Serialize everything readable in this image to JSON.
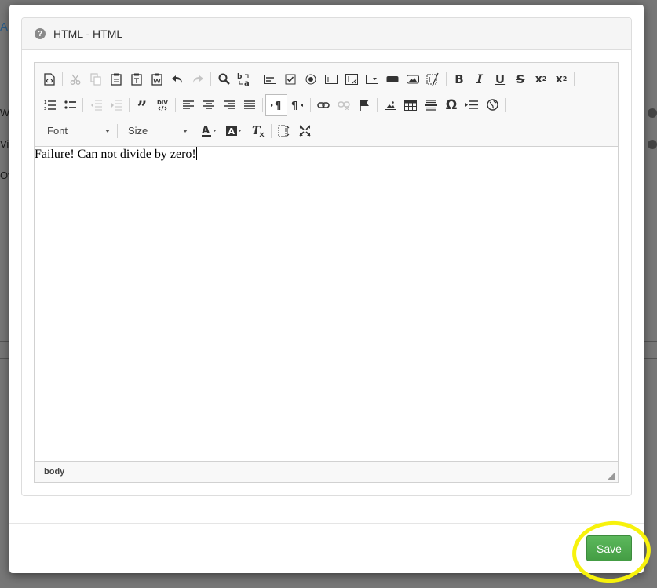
{
  "background": {
    "fragments": [
      "Al",
      "Wa",
      "Vis",
      "Ov"
    ]
  },
  "dialog": {
    "title": "HTML - HTML",
    "title_icon": "question-circle-icon"
  },
  "toolbar": {
    "font_label": "Font",
    "size_label": "Size",
    "row1_icons": [
      "source-icon",
      "cut-icon",
      "copy-icon",
      "paste-icon",
      "paste-text-icon",
      "paste-word-icon",
      "undo-icon",
      "redo-icon",
      "find-icon",
      "replace-icon",
      "form-icon",
      "checkbox-icon",
      "radio-icon",
      "textfield-icon",
      "textarea-icon",
      "select-icon",
      "button-icon",
      "image-button-icon",
      "hidden-field-icon",
      "bold-icon",
      "italic-icon",
      "underline-icon",
      "strike-icon",
      "subscript-icon",
      "superscript-icon"
    ],
    "row2_icons": [
      "numbered-list-icon",
      "bulleted-list-icon",
      "outdent-icon",
      "indent-icon",
      "blockquote-icon",
      "div-icon",
      "align-left-icon",
      "align-center-icon",
      "align-right-icon",
      "justify-icon",
      "ltr-icon",
      "rtl-icon",
      "link-icon",
      "unlink-icon",
      "anchor-icon",
      "image-icon",
      "table-icon",
      "horizontal-rule-icon",
      "special-char-icon",
      "page-break-icon",
      "iframe-icon"
    ]
  },
  "editor": {
    "content": "Failure! Can not divide by zero!",
    "status_path": "body"
  },
  "footer": {
    "save_label": "Save"
  },
  "colors": {
    "save": "#5cb85c",
    "highlight": "#f7f20c"
  }
}
